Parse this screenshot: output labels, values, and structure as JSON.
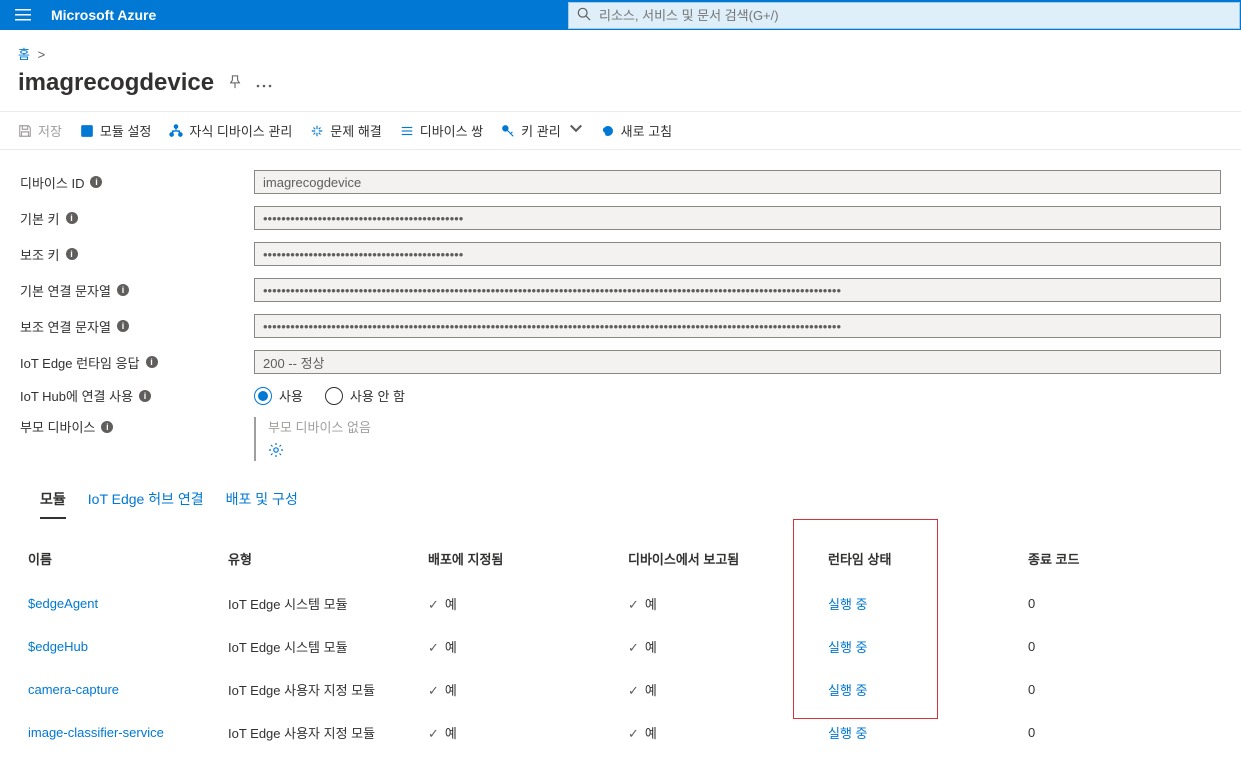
{
  "header": {
    "brand": "Microsoft Azure",
    "search_placeholder": "리소스, 서비스 및 문서 검색(G+/)"
  },
  "breadcrumb": {
    "home": "홈"
  },
  "page": {
    "title": "imagrecogdevice"
  },
  "toolbar": {
    "save": "저장",
    "set_modules": "모듈 설정",
    "child_devices": "자식 디바이스 관리",
    "troubleshoot": "문제 해결",
    "device_twin": "디바이스 쌍",
    "key_mgmt": "키 관리",
    "refresh": "새로 고침"
  },
  "form": {
    "device_id_label": "디바이스 ID",
    "device_id_value": "imagrecogdevice",
    "primary_key_label": "기본 키",
    "primary_key_value": "••••••••••••••••••••••••••••••••••••••••••••",
    "secondary_key_label": "보조 키",
    "secondary_key_value": "••••••••••••••••••••••••••••••••••••••••••••",
    "primary_conn_label": "기본 연결 문자열",
    "primary_conn_value": "•••••••••••••••••••••••••••••••••••••••••••••••••••••••••••••••••••••••••••••••••••••••••••••••••••••••••••••••••••••••••••••••",
    "secondary_conn_label": "보조 연결 문자열",
    "secondary_conn_value": "•••••••••••••••••••••••••••••••••••••••••••••••••••••••••••••••••••••••••••••••••••••••••••••••••••••••••••••••••••••••••••••••",
    "runtime_resp_label": "IoT Edge 런타임 응답",
    "runtime_resp_value": "200 -- 정상",
    "iot_hub_conn_label": "IoT Hub에 연결 사용",
    "radio_enable": "사용",
    "radio_disable": "사용 안 함",
    "parent_device_label": "부모 디바이스",
    "parent_none": "부모 디바이스 없음"
  },
  "tabs": {
    "modules": "모듈",
    "hub_conn": "IoT Edge 허브 연결",
    "deploy_config": "배포 및 구성"
  },
  "table": {
    "columns": {
      "name": "이름",
      "type": "유형",
      "spec_deploy": "배포에 지정됨",
      "reported": "디바이스에서 보고됨",
      "runtime_status": "런타임 상태",
      "exit_code": "종료 코드"
    },
    "rows": [
      {
        "name": "$edgeAgent",
        "type": "IoT Edge 시스템 모듈",
        "spec": "예",
        "reported": "예",
        "status": "실행 중",
        "exit": "0"
      },
      {
        "name": "$edgeHub",
        "type": "IoT Edge 시스템 모듈",
        "spec": "예",
        "reported": "예",
        "status": "실행 중",
        "exit": "0"
      },
      {
        "name": "camera-capture",
        "type": "IoT Edge 사용자 지정 모듈",
        "spec": "예",
        "reported": "예",
        "status": "실행 중",
        "exit": "0"
      },
      {
        "name": "image-classifier-service",
        "type": "IoT Edge 사용자 지정 모듈",
        "spec": "예",
        "reported": "예",
        "status": "실행 중",
        "exit": "0"
      }
    ]
  }
}
